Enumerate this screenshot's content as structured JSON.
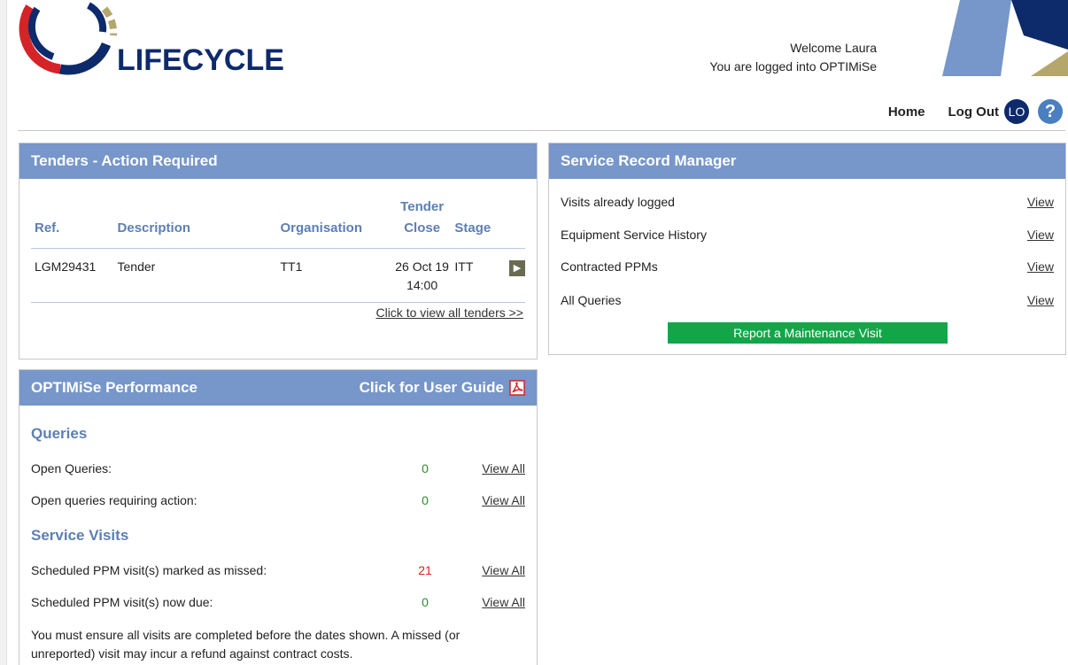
{
  "header": {
    "logo_text": "LIFECYCLE",
    "welcome_line1": "Welcome Laura",
    "welcome_line2": "You are logged into OPTIMiSe"
  },
  "nav": {
    "home": "Home",
    "logout": "Log Out",
    "avatar_initials": "LO",
    "help_glyph": "?"
  },
  "tenders": {
    "title": "Tenders - Action Required",
    "headers": {
      "ref": "Ref.",
      "description": "Description",
      "organisation": "Organisation",
      "tender_close_1": "Tender",
      "tender_close_2": "Close",
      "stage": "Stage"
    },
    "rows": [
      {
        "ref": "LGM29431",
        "description": "Tender",
        "organisation": "TT1",
        "close_date": "26 Oct 19",
        "close_time": "14:00",
        "stage": "ITT"
      }
    ],
    "view_all": "Click to view all tenders >>"
  },
  "srm": {
    "title": "Service Record Manager",
    "items": [
      {
        "label": "Visits already logged",
        "action": "View"
      },
      {
        "label": "Equipment Service History",
        "action": "View"
      },
      {
        "label": "Contracted PPMs",
        "action": "View"
      },
      {
        "label": "All Queries",
        "action": "View"
      }
    ],
    "report_button": "Report a Maintenance Visit"
  },
  "performance": {
    "title": "OPTIMiSe Performance",
    "guide_link": "Click for User Guide",
    "queries_title": "Queries",
    "queries": [
      {
        "label": "Open Queries:",
        "value": "0",
        "action": "View All"
      },
      {
        "label": "Open queries requiring action:",
        "value": "0",
        "action": "View All"
      }
    ],
    "visits_title": "Service Visits",
    "visits": [
      {
        "label": "Scheduled PPM visit(s) marked as missed:",
        "value": "21",
        "action": "View All"
      },
      {
        "label": "Scheduled PPM visit(s) now due:",
        "value": "0",
        "action": "View All"
      }
    ],
    "note": "You must ensure all visits are completed before the dates shown. A missed (or unreported) visit may incur a refund against contract costs."
  },
  "colors": {
    "panel_header": "#7796c9",
    "accent_text": "#5d7fb4",
    "ok_value": "#2e8b2e",
    "alert_value": "#e0201b",
    "report_button": "#12a649"
  },
  "icons": [
    "lifecycle-logo",
    "chevron-right-icon",
    "pdf-icon",
    "help-icon"
  ]
}
